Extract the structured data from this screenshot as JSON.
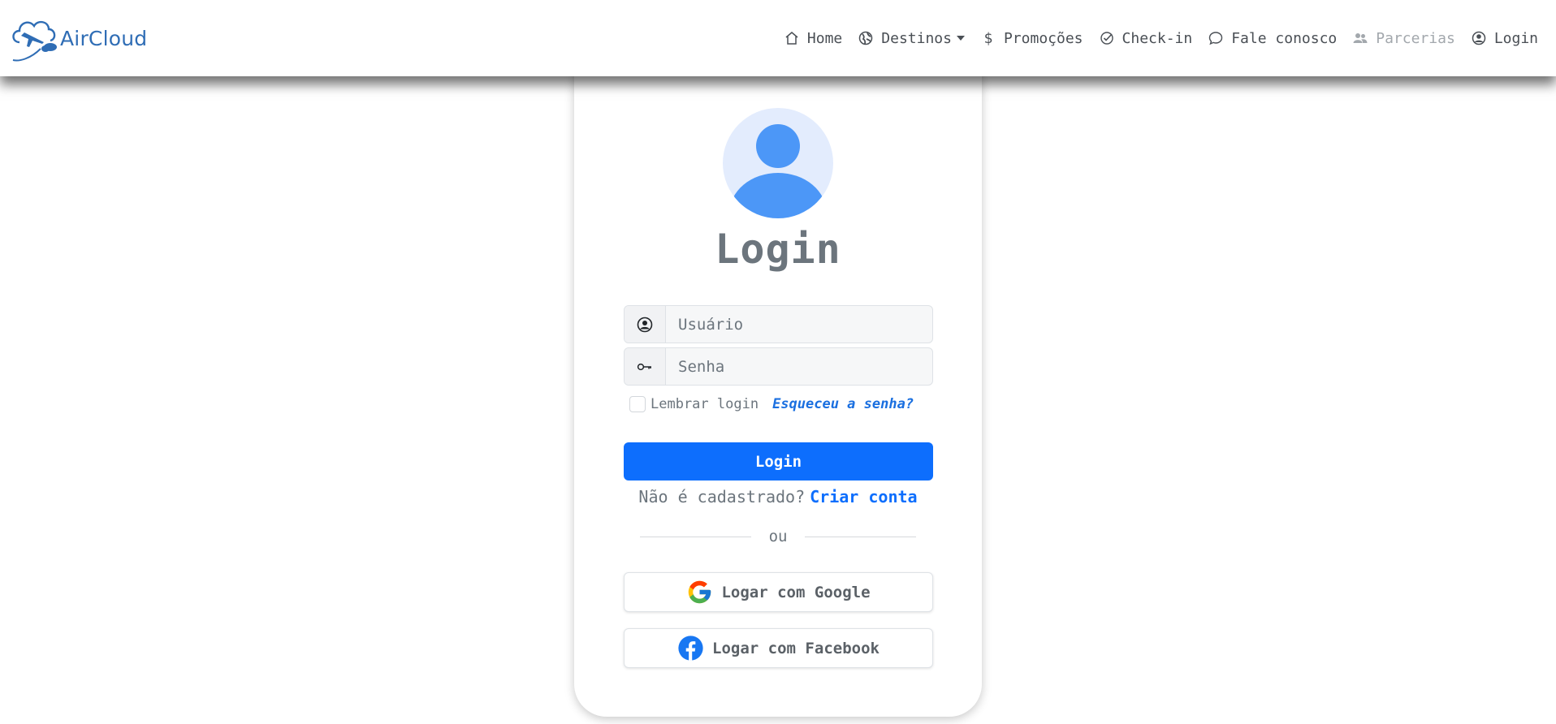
{
  "brand": {
    "name": "AirCloud",
    "logo_icon": "cloud-airplane-logo"
  },
  "nav": {
    "items": [
      {
        "label": "Home",
        "icon": "house-icon"
      },
      {
        "label": "Destinos",
        "icon": "globe-icon",
        "dropdown": true
      },
      {
        "label": "Promoções",
        "icon": "dollar-icon"
      },
      {
        "label": "Check-in",
        "icon": "check-circle-icon"
      },
      {
        "label": "Fale conosco",
        "icon": "chat-icon"
      },
      {
        "label": "Parcerias",
        "icon": "people-icon",
        "disabled": true
      },
      {
        "label": "Login",
        "icon": "person-circle-icon"
      }
    ]
  },
  "login": {
    "title": "Login",
    "username_placeholder": "Usuário",
    "password_placeholder": "Senha",
    "remember_label": "Lembrar login",
    "remember_checked": false,
    "forgot_link": "Esqueceu a senha?",
    "submit_label": "Login",
    "register_question": "Não é cadastrado?",
    "register_link": "Criar conta",
    "divider_text": "ou",
    "google_label": "Logar com Google",
    "facebook_label": "Logar com Facebook"
  },
  "colors": {
    "primary": "#0d6efd",
    "brand": "#2f6db5",
    "avatar_bg": "#e3ecfd",
    "avatar_fg": "#4c97f7",
    "facebook": "#1877f2"
  }
}
